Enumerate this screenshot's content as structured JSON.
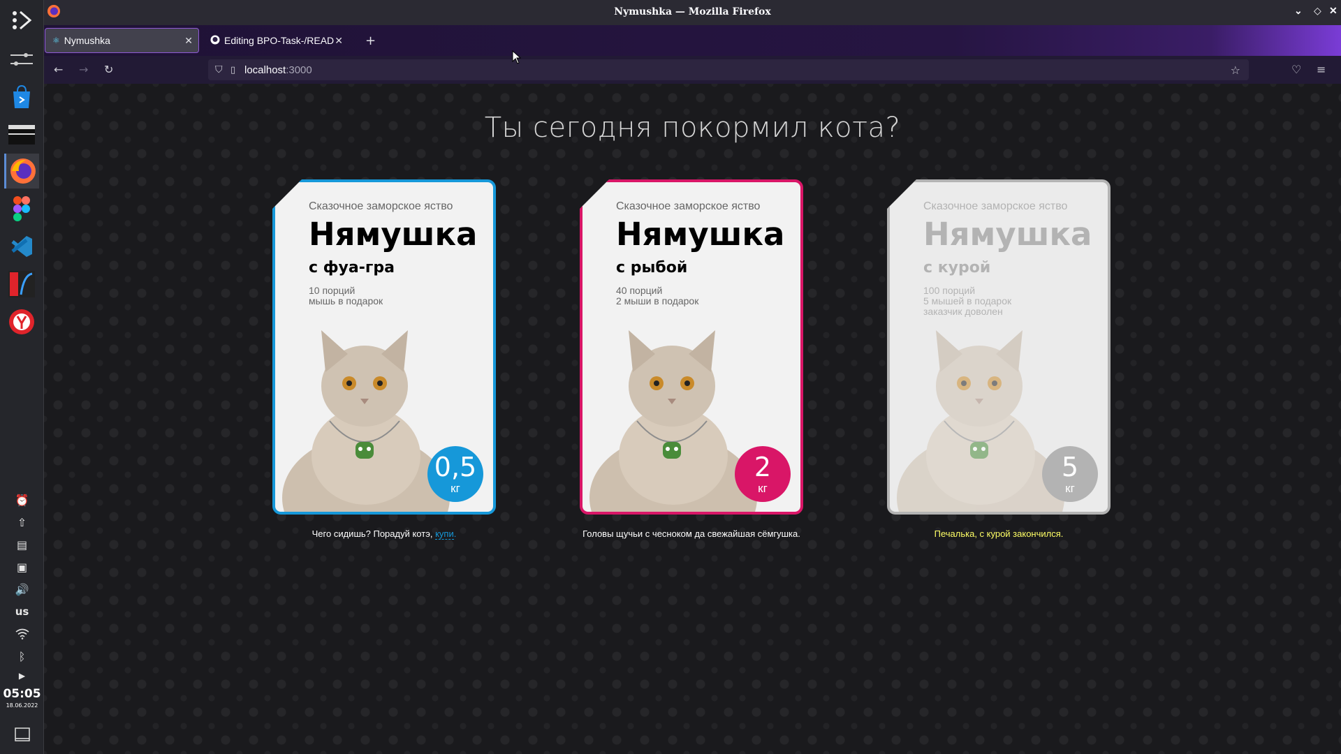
{
  "window": {
    "title": "Nymushka — Mozilla Firefox"
  },
  "tabs": [
    {
      "label": "Nymushka",
      "active": true
    },
    {
      "label": "Editing BPO-Task-/READ",
      "active": false
    }
  ],
  "url": {
    "host": "localhost",
    "port": ":3000"
  },
  "dock": {
    "keyboard_layout": "us",
    "time": "05:05",
    "date": "18.06.2022"
  },
  "page": {
    "headline": "Ты сегодня покормил кота?",
    "cards": [
      {
        "tagline": "Сказочное заморское яство",
        "brand": "Нямушка",
        "flavor": "с фуа-гра",
        "details": [
          "10 порций",
          "мышь в подарок"
        ],
        "weight": "0,5",
        "unit": "кг",
        "state": "default",
        "caption_text": "Чего сидишь? Порадуй котэ, ",
        "caption_link": "купи",
        "caption_end": "."
      },
      {
        "tagline": "Сказочное заморское яство",
        "brand": "Нямушка",
        "flavor": "с рыбой",
        "details": [
          "40 порций",
          "2 мыши в подарок"
        ],
        "weight": "2",
        "unit": "кг",
        "state": "selected",
        "caption_text": "Головы щучьи с чесноком да свежайшая сёмгушка."
      },
      {
        "tagline": "Сказочное заморское яство",
        "brand": "Нямушка",
        "flavor": "с курой",
        "details": [
          "100 порций",
          "5 мышей в подарок",
          "заказчик доволен"
        ],
        "weight": "5",
        "unit": "кг",
        "state": "disabled",
        "caption_text": "Печалька, с курой закончился."
      }
    ]
  },
  "colors": {
    "default": "#1698d9",
    "selected": "#d91667",
    "disabled": "#b3b3b3",
    "sold_caption": "#ffff66"
  }
}
